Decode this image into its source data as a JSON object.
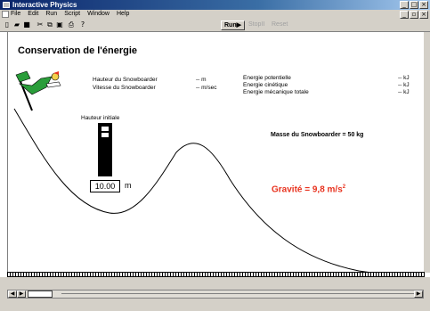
{
  "window": {
    "title": "Interactive Physics"
  },
  "menu": {
    "items": [
      "File",
      "Edit",
      "Run",
      "Script",
      "Window",
      "Help"
    ]
  },
  "toolbar": {
    "run_label": "Run▶",
    "stop_label": "StopII",
    "reset_label": "Reset"
  },
  "sim": {
    "title": "Conservation de l'énergie",
    "readouts_left": [
      {
        "label": "Hauteur du Snowboarder",
        "value": "-- m"
      },
      {
        "label": "Vitesse du Snowboarder",
        "value": "-- m/sec"
      }
    ],
    "readouts_right": [
      {
        "label": "Energie potentielle",
        "value": "-- kJ"
      },
      {
        "label": "Energie cinétique",
        "value": "-- kJ"
      },
      {
        "label": "Energie mécanique totale",
        "value": "-- kJ"
      }
    ],
    "height_control": {
      "label": "Hauteur initiale",
      "value": "10.00",
      "unit": "m"
    },
    "mass_text": "Masse du Snowboarder = 50 kg",
    "gravity_text": "Gravité = 9,8 m/s",
    "gravity_sup": "2"
  },
  "colors": {
    "accent_red": "#e8331f",
    "titlebar": "#0a246a",
    "chrome": "#d4d0c8"
  }
}
